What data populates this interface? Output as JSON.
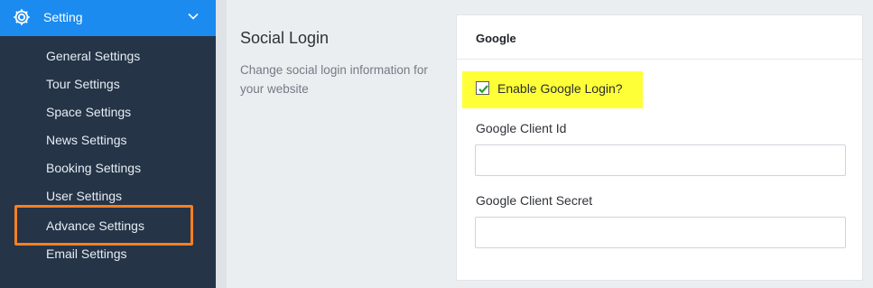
{
  "sidebar": {
    "header": {
      "label": "Setting",
      "icon": "gear-icon",
      "chevron": "chevron-down-icon"
    },
    "items": [
      {
        "label": "General Settings"
      },
      {
        "label": "Tour Settings"
      },
      {
        "label": "Space Settings"
      },
      {
        "label": "News Settings"
      },
      {
        "label": "Booking Settings"
      },
      {
        "label": "User Settings"
      },
      {
        "label": "Advance Settings",
        "highlighted": true
      },
      {
        "label": "Email Settings"
      }
    ]
  },
  "section": {
    "title": "Social Login",
    "description": "Change social login information for your website"
  },
  "card": {
    "title": "Google",
    "enable_checkbox": {
      "label": "Enable Google Login?",
      "checked": true
    },
    "client_id": {
      "label": "Google Client Id",
      "value": "",
      "placeholder": ""
    },
    "client_secret": {
      "label": "Google Client Secret",
      "value": "",
      "placeholder": ""
    }
  },
  "colors": {
    "sidebar_bg": "#253447",
    "header_bg": "#1b8bf0",
    "highlight_border": "#f57f21",
    "yellow_highlight": "#ffff38",
    "check_color": "#2e9a2e"
  }
}
